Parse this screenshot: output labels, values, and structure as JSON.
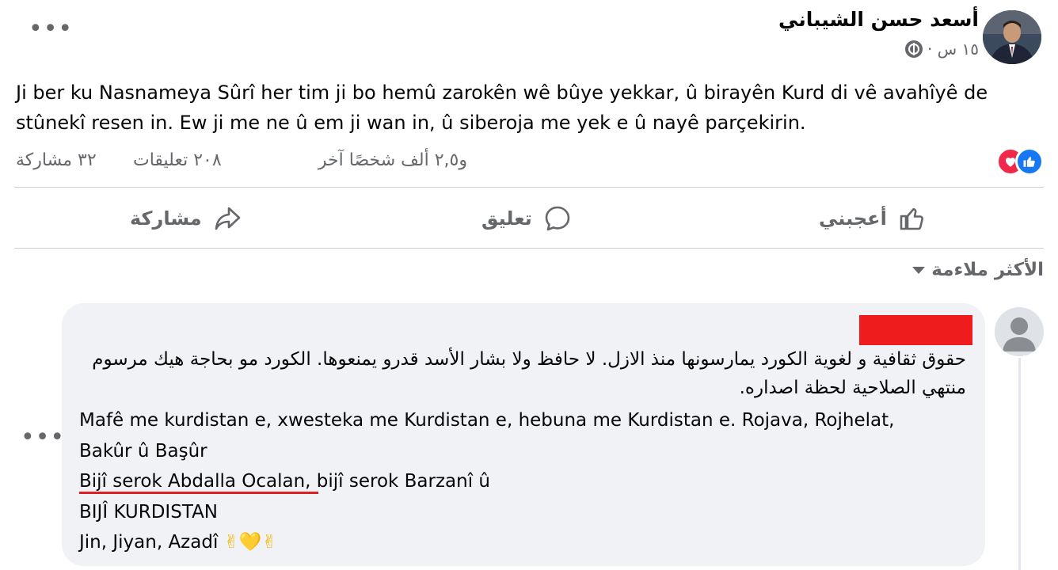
{
  "post": {
    "author": "أسعد حسن الشيباني",
    "time": "١٥ س ·",
    "text": "Ji ber ku Nasnameya Sûrî her tim ji bo hemû zarokên wê bûye yekkar, û birayên Kurd di vê avahîyê de stûnekî resen in. Ew ji me ne û em ji wan in, û siberoja me yek e û nayê parçekirin.",
    "more_options": "•••"
  },
  "stats": {
    "reactions_text": "و٢,٥ ألف شخصًا آخر",
    "comments_text": "٢٠٨ تعليقات",
    "shares_text": "٣٢ مشاركة"
  },
  "actions": {
    "like_label": "أعجبني",
    "comment_label": "تعليق",
    "share_label": "مشاركة"
  },
  "comments_filter": {
    "label": "الأكثر ملاءمة"
  },
  "comment": {
    "arabic_text": "حقوق ثقافية و لغوية الكورد يمارسونها منذ الازل. لا حافظ ولا بشار الأسد قدرو يمنعوها. الكورد مو بحاجة هيك مرسوم منتهي الصلاحية لحظة اصداره.",
    "lines": [
      "Mafê me kurdistan e, xwesteka me Kurdistan e, hebuna me Kurdistan e. Rojava, Rojhelat,",
      "Bakûr û Başûr",
      "Bijî serok Abdalla Ocalan, bijî serok Barzanî û",
      "BIJÎ KURDISTAN",
      "Jin, Jiyan, Azadî"
    ],
    "emoji": "✌💛✌",
    "more_options": "•••"
  },
  "colors": {
    "like_blue": "#1877f2",
    "love_red": "#f02849",
    "muted": "#65676b",
    "bubble": "#f0f2f5",
    "redaction": "#ee1c1c"
  }
}
